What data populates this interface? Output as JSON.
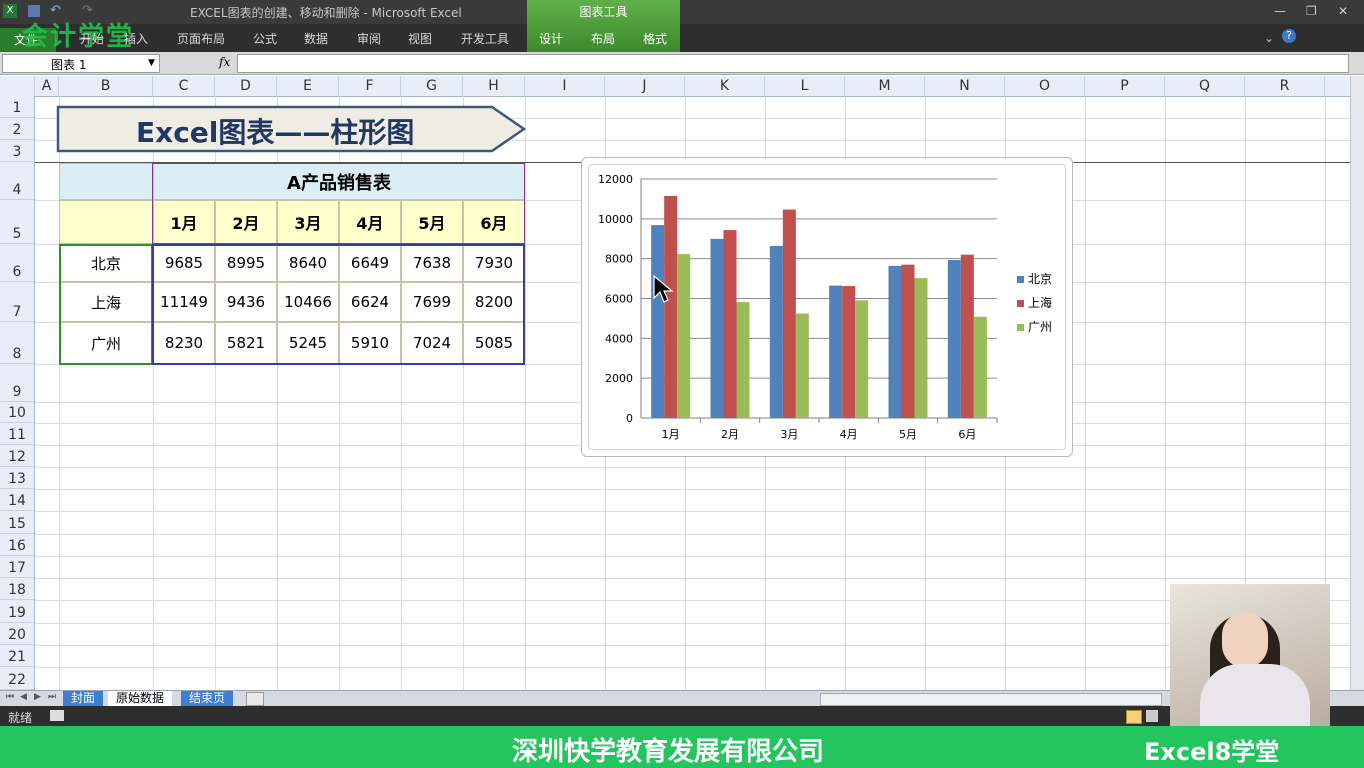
{
  "window": {
    "title": "EXCEL图表的创建、移动和删除 - Microsoft Excel",
    "context_group": "图表工具",
    "logo": "会计学堂"
  },
  "ribbon": {
    "file_tab": "文件",
    "tabs": [
      "开始",
      "插入",
      "页面布局",
      "公式",
      "数据",
      "审阅",
      "视图",
      "开发工具"
    ],
    "context_tabs": [
      "设计",
      "布局",
      "格式"
    ]
  },
  "formula_bar": {
    "name_box": "图表 1",
    "fx": "fx",
    "value": ""
  },
  "columns": [
    "A",
    "B",
    "C",
    "D",
    "E",
    "F",
    "G",
    "H",
    "I",
    "J",
    "K",
    "L",
    "M",
    "N",
    "O",
    "P",
    "Q",
    "R"
  ],
  "rows": [
    "1",
    "2",
    "3",
    "4",
    "5",
    "6",
    "7",
    "8",
    "9",
    "10",
    "11",
    "12",
    "13",
    "14",
    "15",
    "16",
    "17",
    "18",
    "19",
    "20",
    "21",
    "22"
  ],
  "banner": {
    "title": "Excel图表——柱形图"
  },
  "table": {
    "title": "A产品销售表",
    "months": [
      "1月",
      "2月",
      "3月",
      "4月",
      "5月",
      "6月"
    ],
    "rows": [
      {
        "city": "北京",
        "values": [
          "9685",
          "8995",
          "8640",
          "6649",
          "7638",
          "7930"
        ]
      },
      {
        "city": "上海",
        "values": [
          "11149",
          "9436",
          "10466",
          "6624",
          "7699",
          "8200"
        ]
      },
      {
        "city": "广州",
        "values": [
          "8230",
          "5821",
          "5245",
          "5910",
          "7024",
          "5085"
        ]
      }
    ]
  },
  "chart_data": {
    "type": "bar",
    "categories": [
      "1月",
      "2月",
      "3月",
      "4月",
      "5月",
      "6月"
    ],
    "series": [
      {
        "name": "北京",
        "values": [
          9685,
          8995,
          8640,
          6649,
          7638,
          7930
        ],
        "color": "#4f81bd"
      },
      {
        "name": "上海",
        "values": [
          11149,
          9436,
          10466,
          6624,
          7699,
          8200
        ],
        "color": "#c0504d"
      },
      {
        "name": "广州",
        "values": [
          8230,
          5821,
          5245,
          5910,
          7024,
          5085
        ],
        "color": "#9bbb59"
      }
    ],
    "y_ticks": [
      "0",
      "2000",
      "4000",
      "6000",
      "8000",
      "10000",
      "12000"
    ],
    "ylim": [
      0,
      12000
    ],
    "grid": true,
    "legend": "right"
  },
  "sheets": {
    "tabs": [
      "封面",
      "原始数据",
      "结束页"
    ],
    "active": "原始数据"
  },
  "status": {
    "mode": "就绪"
  },
  "footer": {
    "company": "深圳快学教育发展有限公司",
    "brand": "Excel8学堂"
  }
}
